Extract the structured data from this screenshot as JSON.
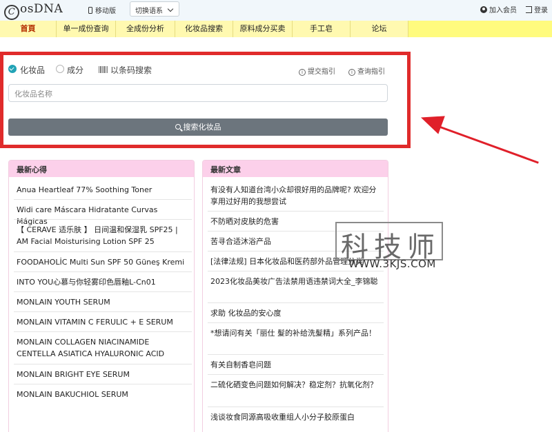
{
  "header": {
    "logo": "osDNA",
    "logo_letter": "C",
    "mobile": "移动版",
    "language": "切换语系",
    "join": "加入会员",
    "login": "登录"
  },
  "nav": {
    "items": [
      "首頁",
      "单一成份查询",
      "全成份分析",
      "化妆品搜索",
      "原料成分买卖",
      "手工皂",
      "论坛"
    ],
    "active": 0
  },
  "search": {
    "options": [
      "化妆品",
      "成分",
      "以条码搜索"
    ],
    "selected": "化妆品",
    "submit_guide": "提交指引",
    "query_guide": "查询指引",
    "placeholder": "化妆品名称",
    "button": "搜索化妆品"
  },
  "latest_reviews": {
    "title": "最新心得",
    "items": [
      "Anua Heartleaf 77% Soothing Toner",
      "Widi care Máscara Hidratante Curvas Mágicas",
      "【 CERAVE 适乐肤 】 日间温和保湿乳 SPF25 | AM Facial Moisturising Lotion SPF 25",
      "FOODAHOLİC Multi Sun SPF 50 Güneş Kremi",
      "INTO YOU心慕与你轻雾印色唇釉L-Cn01",
      "MONLAIN YOUTH SERUM",
      "MONLAIN VITAMIN C FERULIC + E SERUM",
      "MONLAIN COLLAGEN NIACINAMIDE CENTELLA ASIATICA HYALURONIC ACID",
      "MONLAIN BRIGHT EYE SERUM",
      "MONLAIN BAKUCHIOL SERUM"
    ]
  },
  "latest_articles": {
    "title": "最新文章",
    "items": [
      "有没有人知道台湾小众却很好用的品牌呢? 欢迎分享用过好用的我想尝试",
      "不防晒对皮肤的危害",
      "苦寻合适沐浴产品",
      "[法律法规] 日本化妆品和医药部外品管理分类",
      "2023化妆品美妆广告法禁用语违禁词大全_李锦聪",
      "求助 化妆品的安心度",
      "*想请问有关「丽仕 髮的补给洗髮精」系列产品！",
      "有关自制香皂问题",
      "二硫化硒变色问题如何解决？稳定剂？抗氧化剂？",
      "浅谈妆食同源高吸收重组人小分子胶原蛋白"
    ]
  },
  "watermark": {
    "text": "科技师",
    "url": "WWW.3KJS.COM"
  }
}
